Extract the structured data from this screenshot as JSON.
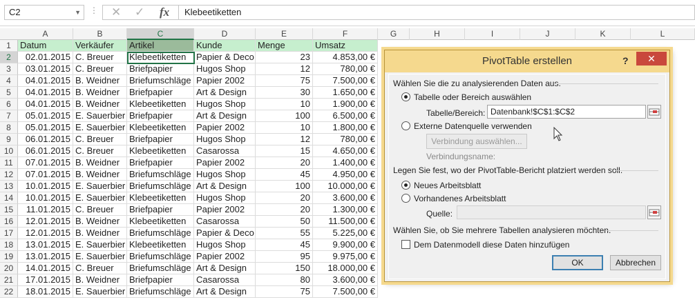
{
  "formula_bar": {
    "name_box": "C2",
    "cancel_icon": "✕",
    "enter_icon": "✓",
    "fx_label": "fx",
    "content": "Klebeetiketten"
  },
  "columns": [
    "A",
    "B",
    "C",
    "D",
    "E",
    "F",
    "G",
    "H",
    "I",
    "J",
    "K",
    "L"
  ],
  "headers": [
    "Datum",
    "Verkäufer",
    "Artikel",
    "Kunde",
    "Menge",
    "Umsatz"
  ],
  "rows": [
    {
      "n": "2",
      "a": "02.01.2015",
      "b": "C. Breuer",
      "c": "Klebeetiketten",
      "d": "Papier & Deco",
      "e": "23",
      "f": "4.853,00 €"
    },
    {
      "n": "3",
      "a": "03.01.2015",
      "b": "C. Breuer",
      "c": "Briefpapier",
      "d": "Hugos Shop",
      "e": "12",
      "f": "780,00 €"
    },
    {
      "n": "4",
      "a": "04.01.2015",
      "b": "B. Weidner",
      "c": "Briefumschläge",
      "d": "Papier 2002",
      "e": "75",
      "f": "7.500,00 €"
    },
    {
      "n": "5",
      "a": "04.01.2015",
      "b": "B. Weidner",
      "c": "Briefpapier",
      "d": "Art & Design",
      "e": "30",
      "f": "1.650,00 €"
    },
    {
      "n": "6",
      "a": "04.01.2015",
      "b": "B. Weidner",
      "c": "Klebeetiketten",
      "d": "Hugos Shop",
      "e": "10",
      "f": "1.900,00 €"
    },
    {
      "n": "7",
      "a": "05.01.2015",
      "b": "E. Sauerbier",
      "c": "Briefpapier",
      "d": "Art & Design",
      "e": "100",
      "f": "6.500,00 €"
    },
    {
      "n": "8",
      "a": "05.01.2015",
      "b": "E. Sauerbier",
      "c": "Klebeetiketten",
      "d": "Papier 2002",
      "e": "10",
      "f": "1.800,00 €"
    },
    {
      "n": "9",
      "a": "06.01.2015",
      "b": "C. Breuer",
      "c": "Briefpapier",
      "d": "Hugos Shop",
      "e": "12",
      "f": "780,00 €"
    },
    {
      "n": "10",
      "a": "06.01.2015",
      "b": "C. Breuer",
      "c": "Klebeetiketten",
      "d": "Casarossa",
      "e": "15",
      "f": "4.650,00 €"
    },
    {
      "n": "11",
      "a": "07.01.2015",
      "b": "B. Weidner",
      "c": "Briefpapier",
      "d": "Papier 2002",
      "e": "20",
      "f": "1.400,00 €"
    },
    {
      "n": "12",
      "a": "07.01.2015",
      "b": "B. Weidner",
      "c": "Briefumschläge",
      "d": "Hugos Shop",
      "e": "45",
      "f": "4.950,00 €"
    },
    {
      "n": "13",
      "a": "10.01.2015",
      "b": "E. Sauerbier",
      "c": "Briefumschläge",
      "d": "Art & Design",
      "e": "100",
      "f": "10.000,00 €"
    },
    {
      "n": "14",
      "a": "10.01.2015",
      "b": "E. Sauerbier",
      "c": "Klebeetiketten",
      "d": "Hugos Shop",
      "e": "20",
      "f": "3.600,00 €"
    },
    {
      "n": "15",
      "a": "11.01.2015",
      "b": "C. Breuer",
      "c": "Briefpapier",
      "d": "Papier 2002",
      "e": "20",
      "f": "1.300,00 €"
    },
    {
      "n": "16",
      "a": "12.01.2015",
      "b": "B. Weidner",
      "c": "Klebeetiketten",
      "d": "Casarossa",
      "e": "50",
      "f": "11.500,00 €"
    },
    {
      "n": "17",
      "a": "12.01.2015",
      "b": "B. Weidner",
      "c": "Briefumschläge",
      "d": "Papier & Deco",
      "e": "55",
      "f": "5.225,00 €"
    },
    {
      "n": "18",
      "a": "13.01.2015",
      "b": "E. Sauerbier",
      "c": "Klebeetiketten",
      "d": "Hugos Shop",
      "e": "45",
      "f": "9.900,00 €"
    },
    {
      "n": "19",
      "a": "13.01.2015",
      "b": "E. Sauerbier",
      "c": "Briefumschläge",
      "d": "Papier 2002",
      "e": "95",
      "f": "9.975,00 €"
    },
    {
      "n": "20",
      "a": "14.01.2015",
      "b": "C. Breuer",
      "c": "Briefumschläge",
      "d": "Art & Design",
      "e": "150",
      "f": "18.000,00 €"
    },
    {
      "n": "21",
      "a": "17.01.2015",
      "b": "B. Weidner",
      "c": "Briefpapier",
      "d": "Casarossa",
      "e": "80",
      "f": "3.600,00 €"
    },
    {
      "n": "22",
      "a": "18.01.2015",
      "b": "E. Sauerbier",
      "c": "Briefumschläge",
      "d": "Art & Design",
      "e": "75",
      "f": "7.500,00 €"
    }
  ],
  "dialog": {
    "title": "PivotTable erstellen",
    "help": "?",
    "close": "✕",
    "section1": "Wählen Sie die zu analysierenden Daten aus.",
    "radio_table": "Tabelle oder Bereich auswählen",
    "range_label": "Tabelle/Bereich:",
    "range_value": "Datenbank!$C$1:$C$2",
    "radio_external": "Externe Datenquelle verwenden",
    "choose_connection": "Verbindung auswählen...",
    "connection_name": "Verbindungsname:",
    "section2": "Legen Sie fest, wo der PivotTable-Bericht platziert werden soll.",
    "radio_new": "Neues Arbeitsblatt",
    "radio_existing": "Vorhandenes Arbeitsblatt",
    "source_label": "Quelle:",
    "section3": "Wählen Sie, ob Sie mehrere Tabellen analysieren möchten.",
    "datamodel_label": "Dem Datenmodell diese Daten hinzufügen",
    "ok": "OK",
    "cancel": "Abbrechen"
  },
  "colors": {
    "header_fill": "#c6efce",
    "accent": "#217346",
    "dialog_frame": "#f5d98e",
    "close_red": "#c9483c"
  }
}
